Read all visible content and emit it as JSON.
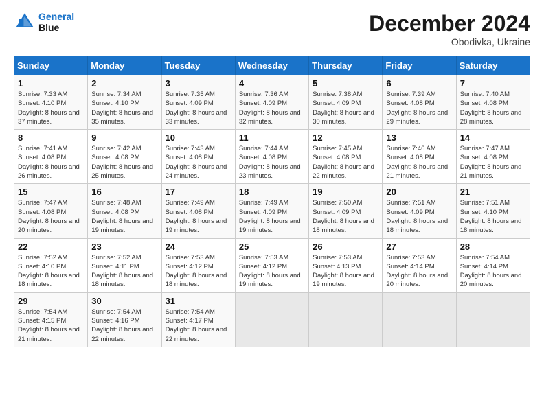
{
  "header": {
    "logo_line1": "General",
    "logo_line2": "Blue",
    "month": "December 2024",
    "location": "Obodivka, Ukraine"
  },
  "days_of_week": [
    "Sunday",
    "Monday",
    "Tuesday",
    "Wednesday",
    "Thursday",
    "Friday",
    "Saturday"
  ],
  "weeks": [
    [
      {
        "day": 1,
        "sunrise": "7:33 AM",
        "sunset": "4:10 PM",
        "daylight": "8 hours and 37 minutes."
      },
      {
        "day": 2,
        "sunrise": "7:34 AM",
        "sunset": "4:10 PM",
        "daylight": "8 hours and 35 minutes."
      },
      {
        "day": 3,
        "sunrise": "7:35 AM",
        "sunset": "4:09 PM",
        "daylight": "8 hours and 33 minutes."
      },
      {
        "day": 4,
        "sunrise": "7:36 AM",
        "sunset": "4:09 PM",
        "daylight": "8 hours and 32 minutes."
      },
      {
        "day": 5,
        "sunrise": "7:38 AM",
        "sunset": "4:09 PM",
        "daylight": "8 hours and 30 minutes."
      },
      {
        "day": 6,
        "sunrise": "7:39 AM",
        "sunset": "4:08 PM",
        "daylight": "8 hours and 29 minutes."
      },
      {
        "day": 7,
        "sunrise": "7:40 AM",
        "sunset": "4:08 PM",
        "daylight": "8 hours and 28 minutes."
      }
    ],
    [
      {
        "day": 8,
        "sunrise": "7:41 AM",
        "sunset": "4:08 PM",
        "daylight": "8 hours and 26 minutes."
      },
      {
        "day": 9,
        "sunrise": "7:42 AM",
        "sunset": "4:08 PM",
        "daylight": "8 hours and 25 minutes."
      },
      {
        "day": 10,
        "sunrise": "7:43 AM",
        "sunset": "4:08 PM",
        "daylight": "8 hours and 24 minutes."
      },
      {
        "day": 11,
        "sunrise": "7:44 AM",
        "sunset": "4:08 PM",
        "daylight": "8 hours and 23 minutes."
      },
      {
        "day": 12,
        "sunrise": "7:45 AM",
        "sunset": "4:08 PM",
        "daylight": "8 hours and 22 minutes."
      },
      {
        "day": 13,
        "sunrise": "7:46 AM",
        "sunset": "4:08 PM",
        "daylight": "8 hours and 21 minutes."
      },
      {
        "day": 14,
        "sunrise": "7:47 AM",
        "sunset": "4:08 PM",
        "daylight": "8 hours and 21 minutes."
      }
    ],
    [
      {
        "day": 15,
        "sunrise": "7:47 AM",
        "sunset": "4:08 PM",
        "daylight": "8 hours and 20 minutes."
      },
      {
        "day": 16,
        "sunrise": "7:48 AM",
        "sunset": "4:08 PM",
        "daylight": "8 hours and 19 minutes."
      },
      {
        "day": 17,
        "sunrise": "7:49 AM",
        "sunset": "4:08 PM",
        "daylight": "8 hours and 19 minutes."
      },
      {
        "day": 18,
        "sunrise": "7:49 AM",
        "sunset": "4:09 PM",
        "daylight": "8 hours and 19 minutes."
      },
      {
        "day": 19,
        "sunrise": "7:50 AM",
        "sunset": "4:09 PM",
        "daylight": "8 hours and 18 minutes."
      },
      {
        "day": 20,
        "sunrise": "7:51 AM",
        "sunset": "4:09 PM",
        "daylight": "8 hours and 18 minutes."
      },
      {
        "day": 21,
        "sunrise": "7:51 AM",
        "sunset": "4:10 PM",
        "daylight": "8 hours and 18 minutes."
      }
    ],
    [
      {
        "day": 22,
        "sunrise": "7:52 AM",
        "sunset": "4:10 PM",
        "daylight": "8 hours and 18 minutes."
      },
      {
        "day": 23,
        "sunrise": "7:52 AM",
        "sunset": "4:11 PM",
        "daylight": "8 hours and 18 minutes."
      },
      {
        "day": 24,
        "sunrise": "7:53 AM",
        "sunset": "4:12 PM",
        "daylight": "8 hours and 18 minutes."
      },
      {
        "day": 25,
        "sunrise": "7:53 AM",
        "sunset": "4:12 PM",
        "daylight": "8 hours and 19 minutes."
      },
      {
        "day": 26,
        "sunrise": "7:53 AM",
        "sunset": "4:13 PM",
        "daylight": "8 hours and 19 minutes."
      },
      {
        "day": 27,
        "sunrise": "7:53 AM",
        "sunset": "4:14 PM",
        "daylight": "8 hours and 20 minutes."
      },
      {
        "day": 28,
        "sunrise": "7:54 AM",
        "sunset": "4:14 PM",
        "daylight": "8 hours and 20 minutes."
      }
    ],
    [
      {
        "day": 29,
        "sunrise": "7:54 AM",
        "sunset": "4:15 PM",
        "daylight": "8 hours and 21 minutes."
      },
      {
        "day": 30,
        "sunrise": "7:54 AM",
        "sunset": "4:16 PM",
        "daylight": "8 hours and 22 minutes."
      },
      {
        "day": 31,
        "sunrise": "7:54 AM",
        "sunset": "4:17 PM",
        "daylight": "8 hours and 22 minutes."
      },
      null,
      null,
      null,
      null
    ]
  ]
}
